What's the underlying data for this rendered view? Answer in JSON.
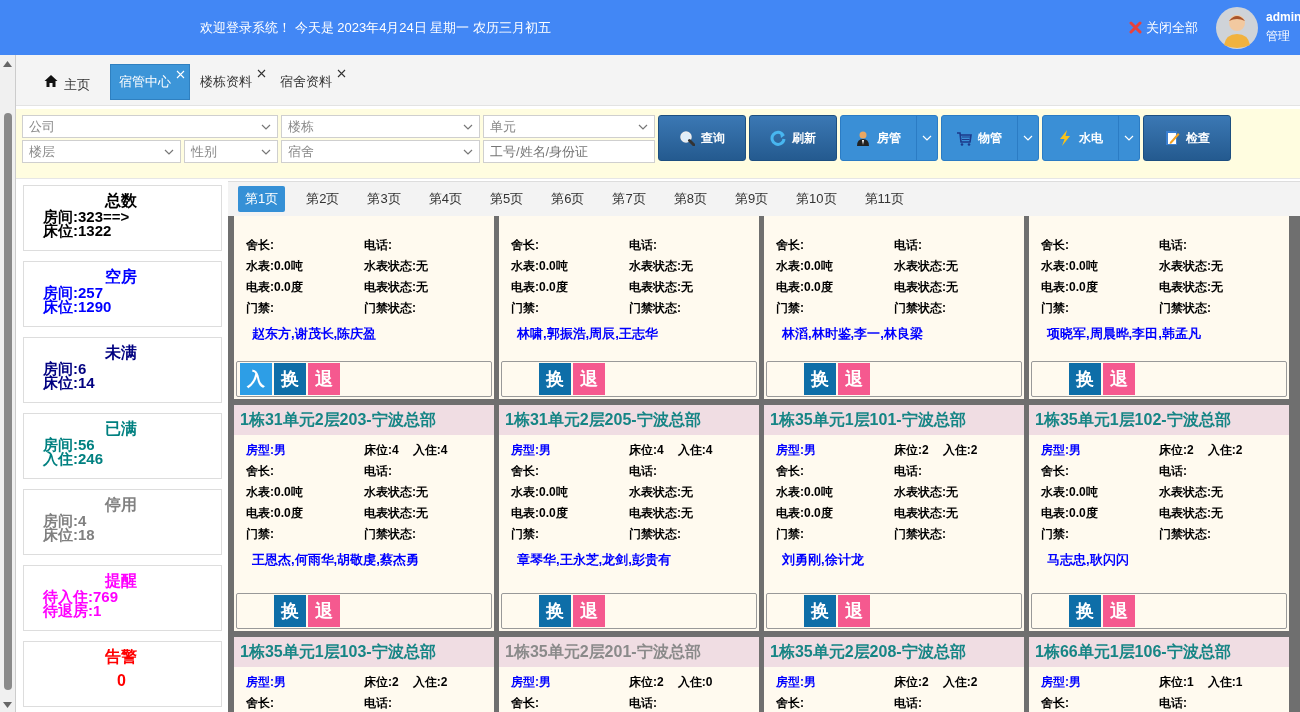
{
  "header": {
    "greeting": "欢迎登录系统！ 今天是 2023年4月24日 星期一 农历三月初五",
    "close_all": "关闭全部",
    "user": "admin",
    "role": "管理"
  },
  "tabs": [
    {
      "label": "主页",
      "kind": "home",
      "selected": false
    },
    {
      "label": "宿管中心",
      "kind": "closable",
      "selected": true
    },
    {
      "label": "楼栋资料",
      "kind": "closable",
      "selected": false
    },
    {
      "label": "宿舍资料",
      "kind": "closable",
      "selected": false
    }
  ],
  "filters": {
    "row1": [
      {
        "placeholder": "公司",
        "kind": "select"
      },
      {
        "placeholder": "楼栋",
        "kind": "select"
      },
      {
        "placeholder": "单元",
        "kind": "select"
      }
    ],
    "row2": [
      {
        "placeholder": "楼层",
        "kind": "select"
      },
      {
        "placeholder": "性别",
        "kind": "select"
      },
      {
        "placeholder": "宿舍",
        "kind": "select"
      },
      {
        "placeholder": "工号/姓名/身份证",
        "kind": "input"
      }
    ]
  },
  "toolbar": [
    {
      "label": "查询",
      "kind": "plain"
    },
    {
      "label": "刷新",
      "kind": "plain"
    },
    {
      "label": "房管",
      "kind": "split"
    },
    {
      "label": "物管",
      "kind": "split"
    },
    {
      "label": "水电",
      "kind": "split"
    },
    {
      "label": "检查",
      "kind": "plain"
    }
  ],
  "stats": [
    {
      "title": "总数",
      "color": "#000000",
      "lines": [
        "房间:323==>",
        "床位:1322"
      ]
    },
    {
      "title": "空房",
      "color": "#0000ff",
      "lines": [
        "房间:257",
        "床位:1290"
      ]
    },
    {
      "title": "未满",
      "color": "#000080",
      "lines": [
        "房间:6",
        "床位:14"
      ]
    },
    {
      "title": "已满",
      "color": "#008080",
      "lines": [
        "房间:56",
        "入住:246"
      ]
    },
    {
      "title": "停用",
      "color": "#808080",
      "lines": [
        "房间:4",
        "床位:18"
      ]
    },
    {
      "title": "提醒",
      "color": "#ff00ff",
      "lines": [
        "待入住:769",
        "待退房:1"
      ]
    },
    {
      "title": "告警",
      "color": "#ff0000",
      "value": "0"
    }
  ],
  "pager": [
    {
      "label": "第1页",
      "selected": true
    },
    {
      "label": "第2页",
      "selected": false
    },
    {
      "label": "第3页",
      "selected": false
    },
    {
      "label": "第4页",
      "selected": false
    },
    {
      "label": "第5页",
      "selected": false
    },
    {
      "label": "第6页",
      "selected": false
    },
    {
      "label": "第7页",
      "selected": false
    },
    {
      "label": "第8页",
      "selected": false
    },
    {
      "label": "第9页",
      "selected": false
    },
    {
      "label": "第10页",
      "selected": false
    },
    {
      "label": "第11页",
      "selected": false
    }
  ],
  "rooms": [
    {
      "rows": [
        [
          "舍长:",
          "电话:"
        ],
        [
          "水表:0.0吨",
          "水表状态:无"
        ],
        [
          "电表:0.0度",
          "电表状态:无"
        ],
        [
          "门禁:",
          "门禁状态:"
        ]
      ],
      "occupants": "赵东方,谢茂长,陈庆盈",
      "actions": [
        {
          "label": "入",
          "kind": "checkin"
        },
        {
          "label": "换",
          "kind": "swap"
        },
        {
          "label": "退",
          "kind": "checkout"
        }
      ]
    },
    {
      "rows": [
        [
          "舍长:",
          "电话:"
        ],
        [
          "水表:0.0吨",
          "水表状态:无"
        ],
        [
          "电表:0.0度",
          "电表状态:无"
        ],
        [
          "门禁:",
          "门禁状态:"
        ]
      ],
      "occupants": "林啸,郭振浩,周辰,王志华",
      "actions": [
        {
          "label": "换",
          "kind": "swap"
        },
        {
          "label": "退",
          "kind": "checkout"
        }
      ]
    },
    {
      "rows": [
        [
          "舍长:",
          "电话:"
        ],
        [
          "水表:0.0吨",
          "水表状态:无"
        ],
        [
          "电表:0.0度",
          "电表状态:无"
        ],
        [
          "门禁:",
          "门禁状态:"
        ]
      ],
      "occupants": "林滔,林时鉴,李一,林良梁",
      "actions": [
        {
          "label": "换",
          "kind": "swap"
        },
        {
          "label": "退",
          "kind": "checkout"
        }
      ]
    },
    {
      "rows": [
        [
          "舍长:",
          "电话:"
        ],
        [
          "水表:0.0吨",
          "水表状态:无"
        ],
        [
          "电表:0.0度",
          "电表状态:无"
        ],
        [
          "门禁:",
          "门禁状态:"
        ]
      ],
      "occupants": "项晓军,周晨晔,李田,韩孟凡",
      "actions": [
        {
          "label": "换",
          "kind": "swap"
        },
        {
          "label": "退",
          "kind": "checkout"
        }
      ]
    },
    {
      "title": "1栋31单元2层203-宁波总部",
      "disabled": false,
      "type": "房型:男",
      "beds": "床位:4",
      "occupied": "入住:4",
      "rows": [
        [
          "舍长:",
          "电话:"
        ],
        [
          "水表:0.0吨",
          "水表状态:无"
        ],
        [
          "电表:0.0度",
          "电表状态:无"
        ],
        [
          "门禁:",
          "门禁状态:"
        ]
      ],
      "occupants": "王恩杰,何雨华,胡敬虔,蔡杰勇",
      "actions": [
        {
          "label": "换",
          "kind": "swap"
        },
        {
          "label": "退",
          "kind": "checkout"
        }
      ]
    },
    {
      "title": "1栋31单元2层205-宁波总部",
      "disabled": false,
      "type": "房型:男",
      "beds": "床位:4",
      "occupied": "入住:4",
      "rows": [
        [
          "舍长:",
          "电话:"
        ],
        [
          "水表:0.0吨",
          "水表状态:无"
        ],
        [
          "电表:0.0度",
          "电表状态:无"
        ],
        [
          "门禁:",
          "门禁状态:"
        ]
      ],
      "occupants": "章琴华,王永芝,龙剑,彭贵有",
      "actions": [
        {
          "label": "换",
          "kind": "swap"
        },
        {
          "label": "退",
          "kind": "checkout"
        }
      ]
    },
    {
      "title": "1栋35单元1层101-宁波总部",
      "disabled": false,
      "type": "房型:男",
      "beds": "床位:2",
      "occupied": "入住:2",
      "rows": [
        [
          "舍长:",
          "电话:"
        ],
        [
          "水表:0.0吨",
          "水表状态:无"
        ],
        [
          "电表:0.0度",
          "电表状态:无"
        ],
        [
          "门禁:",
          "门禁状态:"
        ]
      ],
      "occupants": "刘勇刚,徐计龙",
      "actions": [
        {
          "label": "换",
          "kind": "swap"
        },
        {
          "label": "退",
          "kind": "checkout"
        }
      ]
    },
    {
      "title": "1栋35单元1层102-宁波总部",
      "disabled": false,
      "type": "房型:男",
      "beds": "床位:2",
      "occupied": "入住:2",
      "rows": [
        [
          "舍长:",
          "电话:"
        ],
        [
          "水表:0.0吨",
          "水表状态:无"
        ],
        [
          "电表:0.0度",
          "电表状态:无"
        ],
        [
          "门禁:",
          "门禁状态:"
        ]
      ],
      "occupants": "马志忠,耿闪闪",
      "actions": [
        {
          "label": "换",
          "kind": "swap"
        },
        {
          "label": "退",
          "kind": "checkout"
        }
      ]
    },
    {
      "title": "1栋35单元1层103-宁波总部",
      "disabled": false,
      "type": "房型:男",
      "beds": "床位:2",
      "occupied": "入住:2",
      "rows": [
        [
          "舍长:",
          "电话:"
        ]
      ]
    },
    {
      "title": "1栋35单元2层201-宁波总部",
      "disabled": true,
      "type": "房型:男",
      "beds": "床位:2",
      "occupied": "入住:0",
      "rows": [
        [
          "舍长:",
          "电话:"
        ]
      ]
    },
    {
      "title": "1栋35单元2层208-宁波总部",
      "disabled": false,
      "type": "房型:男",
      "beds": "床位:2",
      "occupied": "入住:2",
      "rows": [
        [
          "舍长:",
          "电话:"
        ]
      ]
    },
    {
      "title": "1栋66单元1层106-宁波总部",
      "disabled": false,
      "type": "房型:男",
      "beds": "床位:1",
      "occupied": "入住:1",
      "rows": [
        [
          "舍长:",
          "电话:"
        ]
      ]
    }
  ]
}
